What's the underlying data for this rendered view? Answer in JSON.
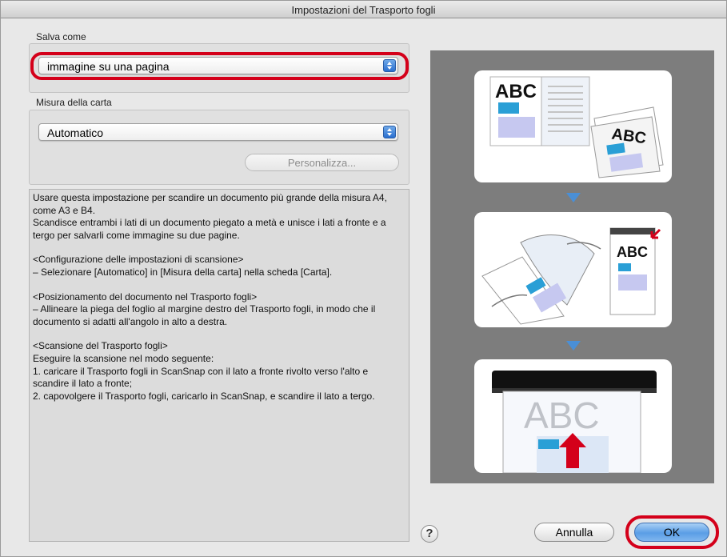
{
  "window": {
    "title": "Impostazioni del Trasporto fogli"
  },
  "save_as": {
    "label": "Salva come",
    "selected": "immagine su una pagina"
  },
  "paper_size": {
    "label": "Misura della carta",
    "selected": "Automatico",
    "customize_label": "Personalizza..."
  },
  "description": {
    "lines": [
      "Usare questa impostazione per scandire un documento più grande della misura A4, come A3 e B4.",
      "Scandisce entrambi i lati di un documento piegato a metà e unisce i lati a fronte e a tergo per salvarli come immagine su due pagine.",
      "",
      "<Configurazione delle impostazioni di scansione>",
      "– Selezionare [Automatico] in [Misura della carta] nella scheda [Carta].",
      "",
      "<Posizionamento del documento nel Trasporto fogli>",
      "– Allineare la piega del foglio al margine destro del Trasporto fogli, in modo che il documento si adatti all'angolo in alto a destra.",
      "",
      "<Scansione del Trasporto fogli>",
      "Eseguire la scansione nel modo seguente:",
      "1. caricare il Trasporto fogli in ScanSnap con il lato a fronte rivolto verso l'alto e scandire il lato a fronte;",
      "2. capovolgere il Trasporto fogli, caricarlo in ScanSnap, e scandire il lato a tergo."
    ]
  },
  "illustration": {
    "step1_text_left": "ABC",
    "step1_text_right": "ABC",
    "step2_text": "ABC",
    "step3_text": "ABC"
  },
  "buttons": {
    "help": "?",
    "cancel": "Annulla",
    "ok": "OK"
  },
  "colors": {
    "highlight": "#d4001a",
    "accent_blue": "#4a8fd6",
    "panel_gray": "#7d7d7d"
  }
}
